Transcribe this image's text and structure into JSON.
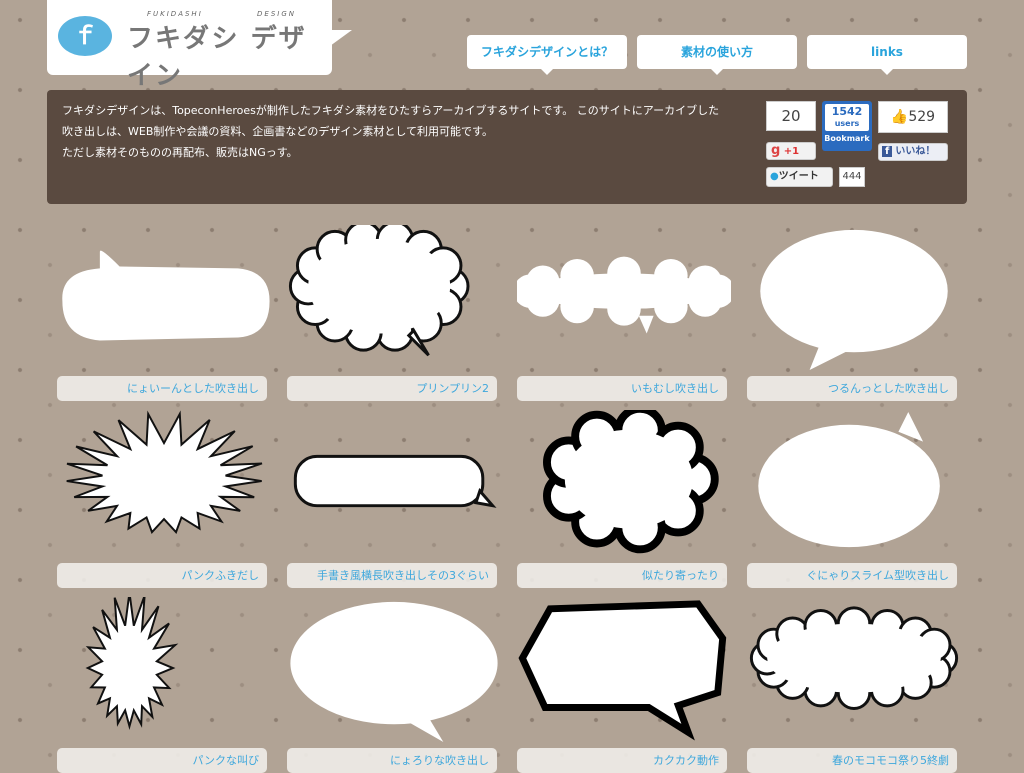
{
  "logo": {
    "icon": "ｆ",
    "text_main": "フキダシ デザイン",
    "sub1": "FUKIDASHI",
    "sub2": "DESIGN"
  },
  "nav": [
    "フキダシデザインとは？",
    "素材の使い方",
    "links"
  ],
  "intro": {
    "text1": "フキダシデザインは、TopeconHeroesが制作したフキダシ素材をひたすらアーカイブするサイトです。 このサイトにアーカイブした吹き出しは、WEB制作や会議の資料、企画書などのデザイン素材として利用可能です。",
    "text2": "ただし素材そのものの再配布、販売はNGっす。"
  },
  "social": {
    "gplus_count": "20",
    "gplus_label": "+1",
    "hatena_count": "1542",
    "hatena_users": "users",
    "hatena_label": "Bookmark",
    "fb_count": "529",
    "fb_label": "いいね！",
    "tweet_label": "ツイート",
    "tweet_count": "444"
  },
  "items": [
    {
      "label": "にょいーんとした吹き出し"
    },
    {
      "label": "プリンプリン2"
    },
    {
      "label": "いもむし吹き出し"
    },
    {
      "label": "つるんっとした吹き出し"
    },
    {
      "label": "パンクふきだし"
    },
    {
      "label": "手書き風横長吹き出しその3ぐらい"
    },
    {
      "label": "似たり寄ったり"
    },
    {
      "label": "ぐにゃりスライム型吹き出し"
    },
    {
      "label": "パンクな叫び"
    },
    {
      "label": "にょろりな吹き出し"
    },
    {
      "label": "カクカク動作"
    },
    {
      "label": "春のモコモコ祭り5終劇"
    }
  ]
}
